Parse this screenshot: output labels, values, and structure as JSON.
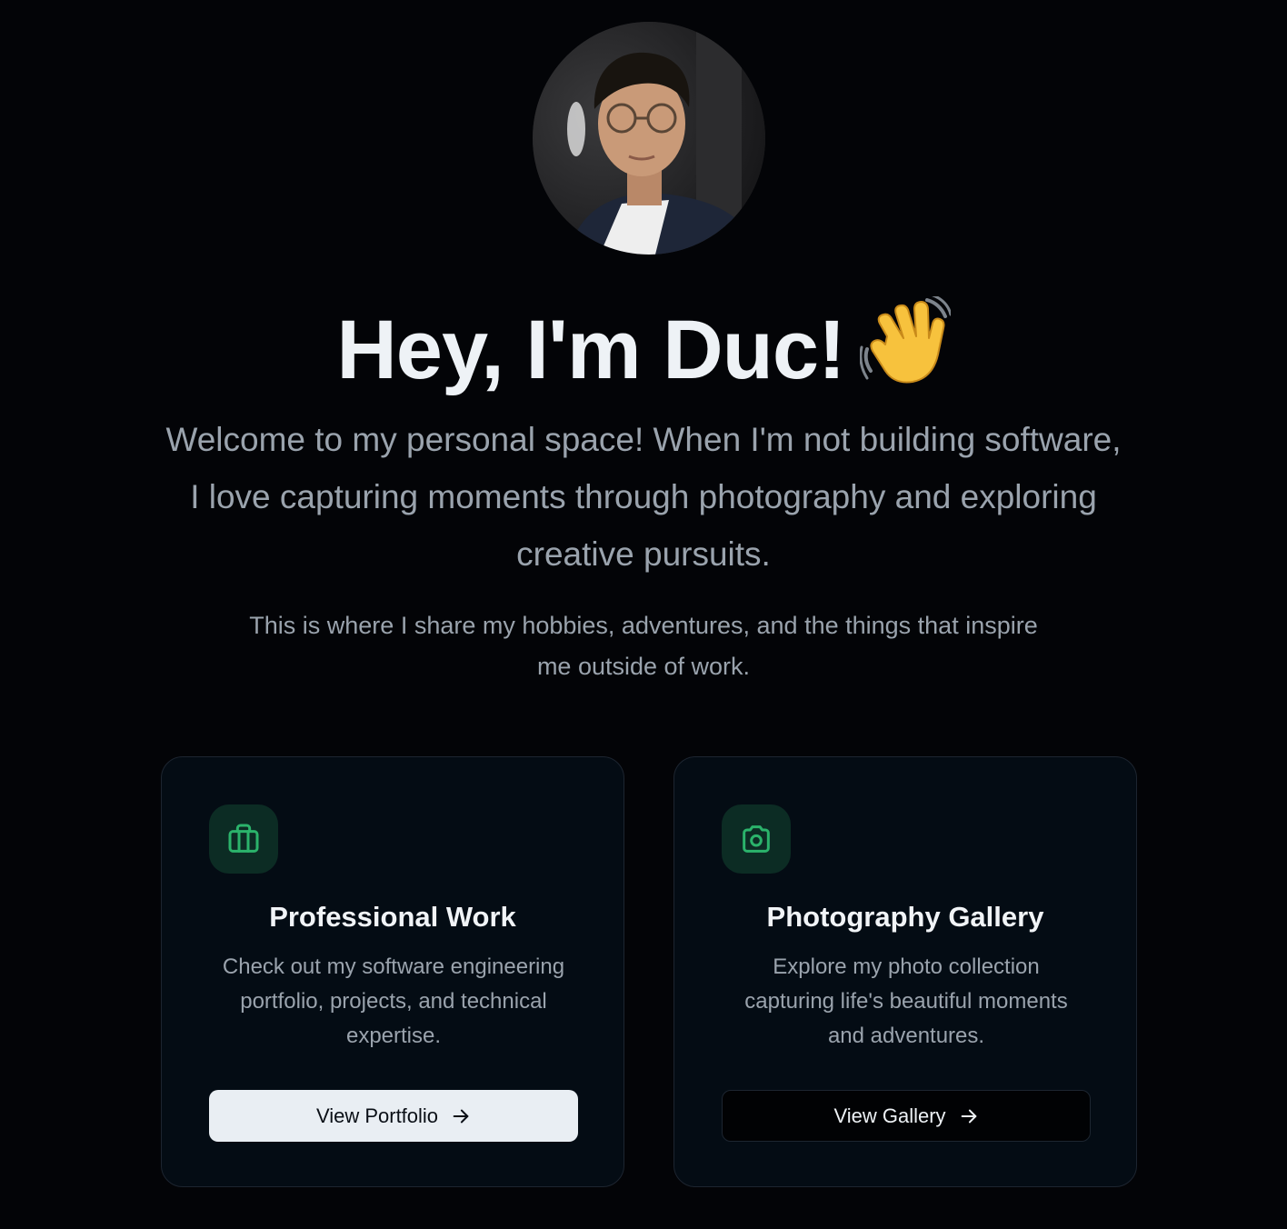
{
  "profile": {
    "avatar_alt": "Profile photo"
  },
  "hero": {
    "greeting": "Hey, I'm Duc!",
    "wave_icon": "waving-hand-emoji",
    "intro": "Welcome to my personal space! When I'm not building software, I love capturing moments through photography and exploring creative pursuits.",
    "sub": "This is where I share my hobbies, adventures, and the things that inspire me outside of work."
  },
  "cards": [
    {
      "icon": "briefcase-icon",
      "title": "Professional Work",
      "description": "Check out my software engineering portfolio, projects, and technical expertise.",
      "button_label": "View Portfolio"
    },
    {
      "icon": "camera-icon",
      "title": "Photography Gallery",
      "description": "Explore my photo collection capturing life's beautiful moments and adventures.",
      "button_label": "View Gallery"
    }
  ],
  "colors": {
    "background": "#030407",
    "card_background": "#040c14",
    "accent_green": "#2bb36b",
    "icon_box": "#0c2c24",
    "muted_text": "#9aa3ad"
  }
}
